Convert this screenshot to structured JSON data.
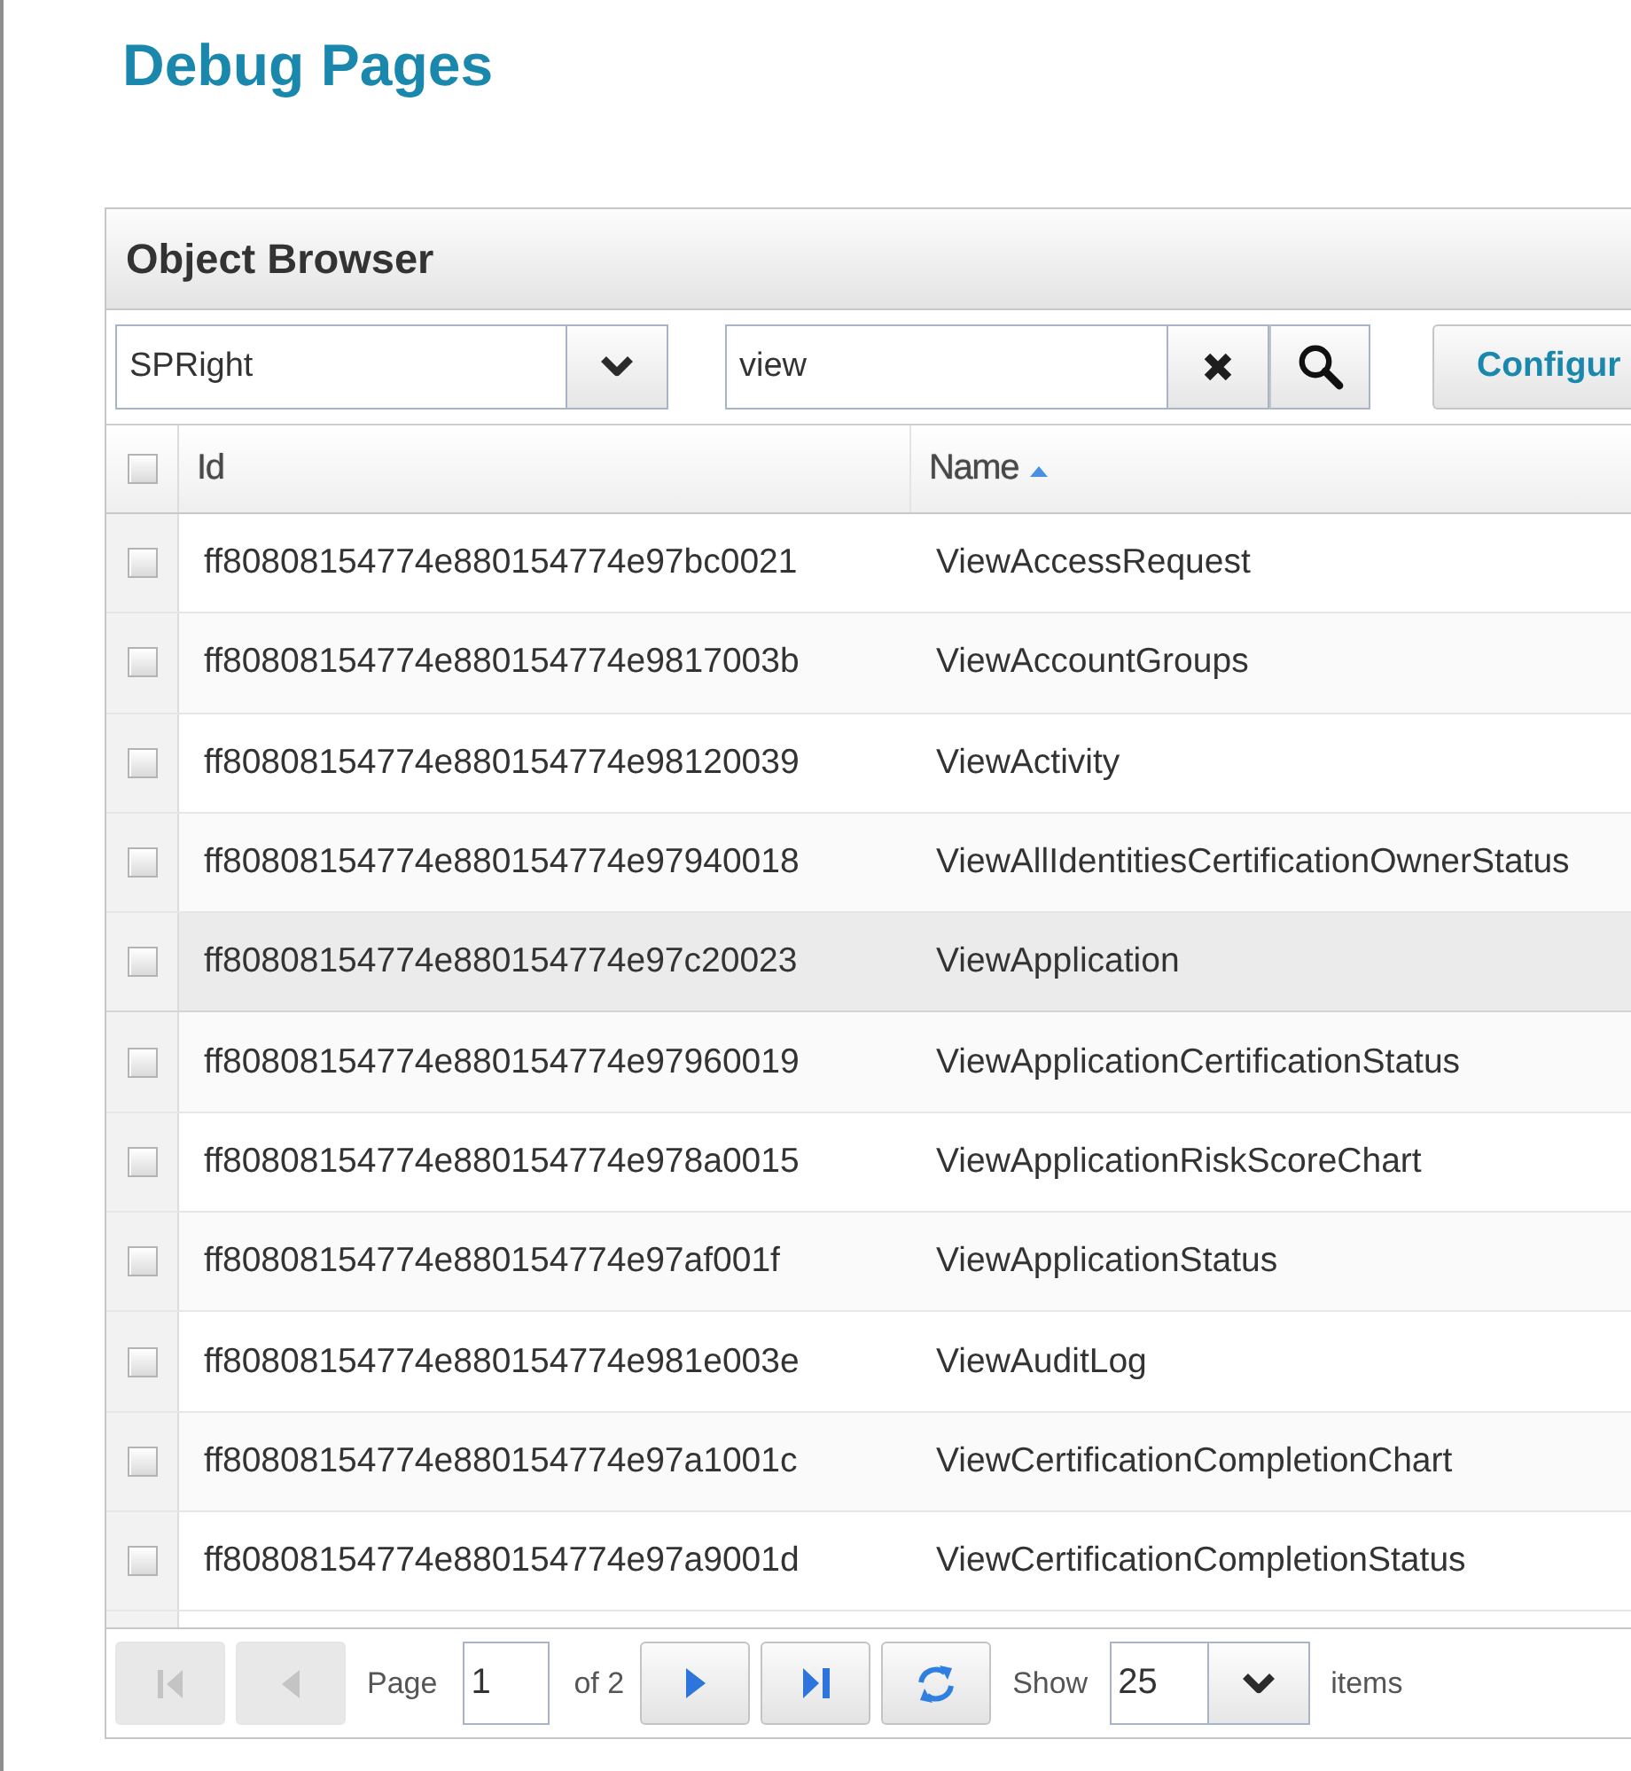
{
  "page": {
    "title": "Debug Pages"
  },
  "object_browser": {
    "title": "Object Browser",
    "toolbar": {
      "class_select": {
        "value": "SPRight"
      },
      "search": {
        "value": "view"
      },
      "configure_button": {
        "label": "Configur"
      }
    },
    "table": {
      "select_all": {
        "checked": false
      },
      "columns": [
        {
          "label": "Id",
          "sorted": false
        },
        {
          "label": "Name",
          "sorted": true
        }
      ],
      "rows": [
        {
          "id": "ff80808154774e880154774e97bc0021",
          "name": "ViewAccessRequest",
          "checked": false,
          "highlighted": false
        },
        {
          "id": "ff80808154774e880154774e9817003b",
          "name": "ViewAccountGroups",
          "checked": false,
          "highlighted": false
        },
        {
          "id": "ff80808154774e880154774e98120039",
          "name": "ViewActivity",
          "checked": false,
          "highlighted": false
        },
        {
          "id": "ff80808154774e880154774e97940018",
          "name": "ViewAllIdentitiesCertificationOwnerStatus",
          "checked": false,
          "highlighted": false
        },
        {
          "id": "ff80808154774e880154774e97c20023",
          "name": "ViewApplication",
          "checked": false,
          "highlighted": true
        },
        {
          "id": "ff80808154774e880154774e97960019",
          "name": "ViewApplicationCertificationStatus",
          "checked": false,
          "highlighted": false
        },
        {
          "id": "ff80808154774e880154774e978a0015",
          "name": "ViewApplicationRiskScoreChart",
          "checked": false,
          "highlighted": false
        },
        {
          "id": "ff80808154774e880154774e97af001f",
          "name": "ViewApplicationStatus",
          "checked": false,
          "highlighted": false
        },
        {
          "id": "ff80808154774e880154774e981e003e",
          "name": "ViewAuditLog",
          "checked": false,
          "highlighted": false
        },
        {
          "id": "ff80808154774e880154774e97a1001c",
          "name": "ViewCertificationCompletionChart",
          "checked": false,
          "highlighted": false
        },
        {
          "id": "ff80808154774e880154774e97a9001d",
          "name": "ViewCertificationCompletionStatus",
          "checked": false,
          "highlighted": false
        }
      ]
    },
    "pager": {
      "first_button": {
        "disabled": true
      },
      "prev_button": {
        "disabled": true
      },
      "page_label": "Page",
      "page": "1",
      "of_label": "of 2",
      "next_button": {
        "disabled": false
      },
      "last_button": {
        "disabled": false
      },
      "show_label": "Show",
      "page_size": "25",
      "items_label": "items"
    }
  }
}
